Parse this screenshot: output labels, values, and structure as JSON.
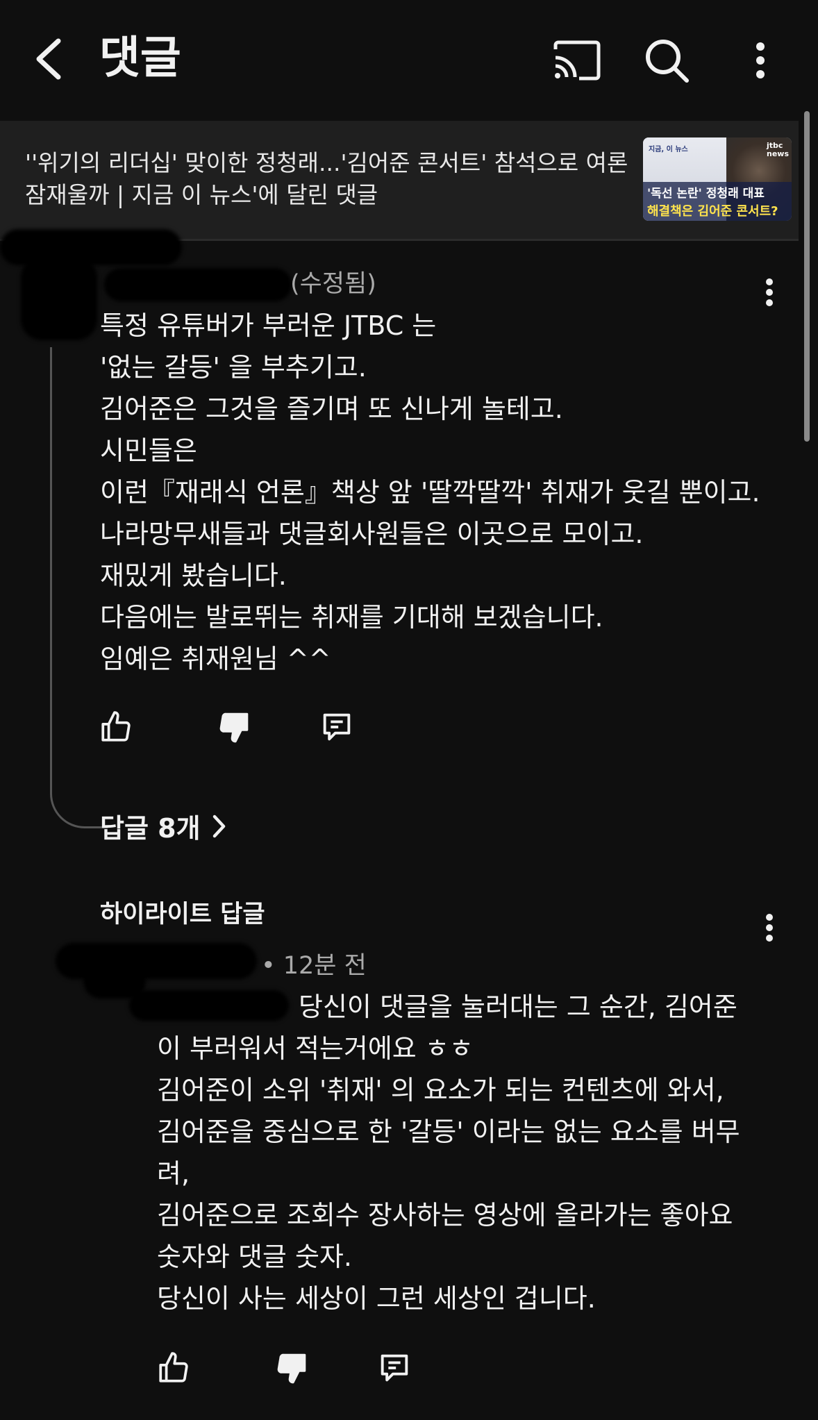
{
  "header": {
    "title": "댓글",
    "back_icon": "chevron-left-icon",
    "cast_icon": "cast-icon",
    "search_icon": "search-icon",
    "more_icon": "more-vertical-icon"
  },
  "video": {
    "title": "''위기의 리더십' 맞이한 정청래...'김어준 콘서트' 참석으로 여론 잠재울까 | 지금 이 뉴스'에 달린 댓글",
    "thumbnail": {
      "caption_line1": "'독선 논란' 정청래 대표",
      "caption_line2": "해결책은 김어준 콘서트?",
      "tag": "지금, 이 뉴스",
      "brand": "jtbc news"
    }
  },
  "comment": {
    "edited": "(수정됨)",
    "body": "특정 유튜버가 부러운 JTBC 는\n'없는 갈등' 을 부추기고.\n김어준은 그것을 즐기며 또 신나게 놀테고.\n시민들은\n이런『재래식 언론』책상 앞 '딸깍딸깍' 취재가 웃길 뿐이고.\n나라망무새들과 댓글회사원들은 이곳으로 모이고.\n재밌게 봤습니다.\n다음에는 발로뛰는 취재를 기대해 보겠습니다.\n임예은 취재원님 ^^",
    "replies_label": "답글 8개"
  },
  "reply": {
    "section_label": "하이라이트 답글",
    "time": "• 12분 전",
    "body": "당신이 댓글을 눌러대는 그 순간, 김어준\n이 부러워서 적는거에요 ㅎㅎ\n김어준이 소위 '취재' 의 요소가 되는 컨텐츠에 와서,\n김어준을 중심으로 한 '갈등' 이라는 없는 요소를 버무\n려,\n김어준으로 조회수 장사하는 영상에 올라가는 좋아요\n숫자와 댓글 숫자.\n당신이 사는 세상이 그런 세상인 겁니다."
  }
}
